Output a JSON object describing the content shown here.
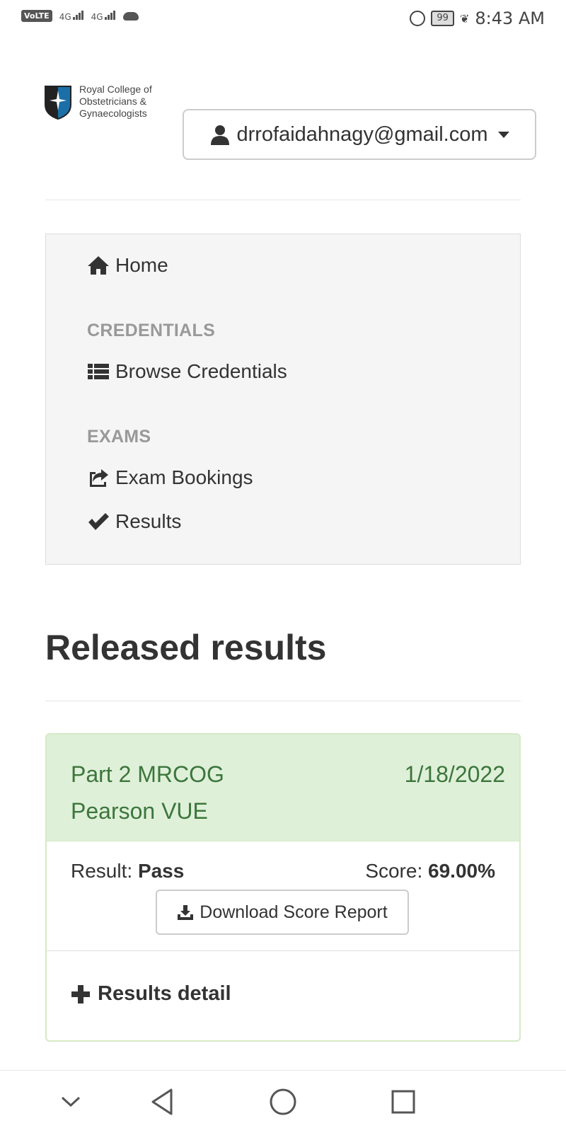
{
  "status_bar": {
    "volte": "VoLTE",
    "network1": "4G",
    "network2": "4G",
    "battery": "99",
    "time": "8:43 AM",
    "icons": [
      "alarm-icon",
      "battery-icon",
      "leaf-icon",
      "cloud-icon"
    ]
  },
  "header": {
    "logo_text": [
      "Royal College of",
      "Obstetricians &",
      "Gynaecologists"
    ],
    "user_email": "drrofaidahnagy@gmail.com"
  },
  "nav": {
    "home": "Home",
    "credentials_header": "CREDENTIALS",
    "browse_credentials": "Browse Credentials",
    "exams_header": "EXAMS",
    "exam_bookings": "Exam Bookings",
    "results": "Results"
  },
  "main": {
    "title": "Released results",
    "result_card": {
      "exam_name": "Part 2 MRCOG",
      "provider": "Pearson VUE",
      "date": "1/18/2022",
      "result_label": "Result:",
      "result_value": "Pass",
      "score_label": "Score:",
      "score_value": "69.00%",
      "download_button": "Download Score Report",
      "details_toggle": "Results detail"
    }
  },
  "colors": {
    "success_bg": "#dff0d8",
    "success_text": "#3c763d",
    "nav_bg": "#f5f5f5",
    "muted_header": "#999999"
  }
}
